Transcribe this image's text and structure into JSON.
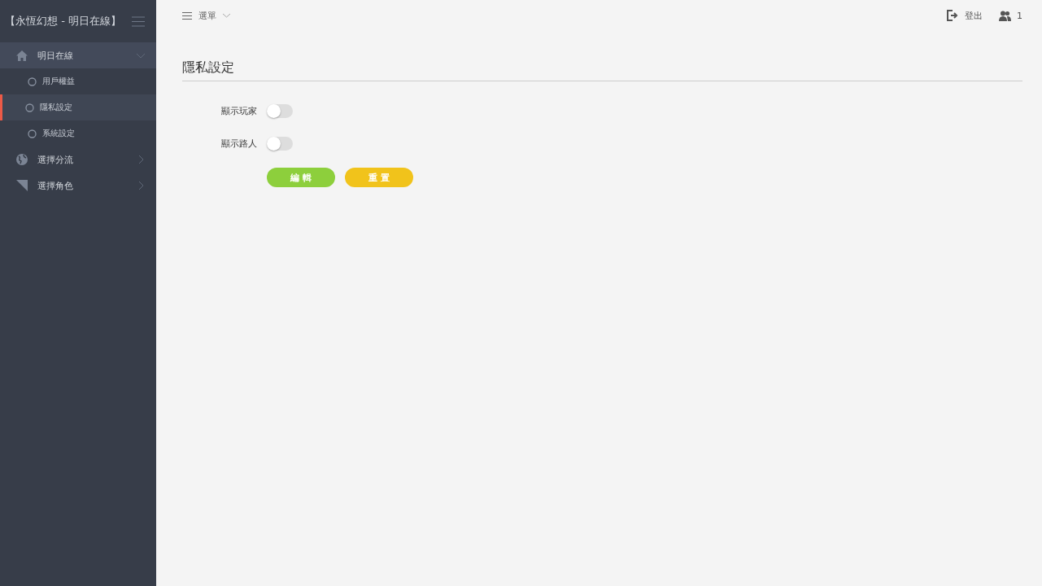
{
  "sidebar": {
    "title": "【永恆幻想 - 明日在線】",
    "items": [
      {
        "label": "明日在線",
        "expanded": true,
        "children": [
          {
            "label": "用戶權益",
            "selected": false
          },
          {
            "label": "隱私設定",
            "selected": true
          },
          {
            "label": "系統設定",
            "selected": false
          }
        ]
      },
      {
        "label": "選擇分流",
        "expanded": false
      },
      {
        "label": "選擇角色",
        "expanded": false
      }
    ]
  },
  "topbar": {
    "menu": "選單",
    "logout": "登出",
    "users": "1"
  },
  "page": {
    "title": "隱私設定",
    "toggles": [
      {
        "label": "顯示玩家",
        "on": false
      },
      {
        "label": "顯示路人",
        "on": false
      }
    ],
    "buttons": [
      {
        "label": "編 輯",
        "color": "#8dcf3c"
      },
      {
        "label": "重 置",
        "color": "#f1c31b"
      }
    ]
  }
}
